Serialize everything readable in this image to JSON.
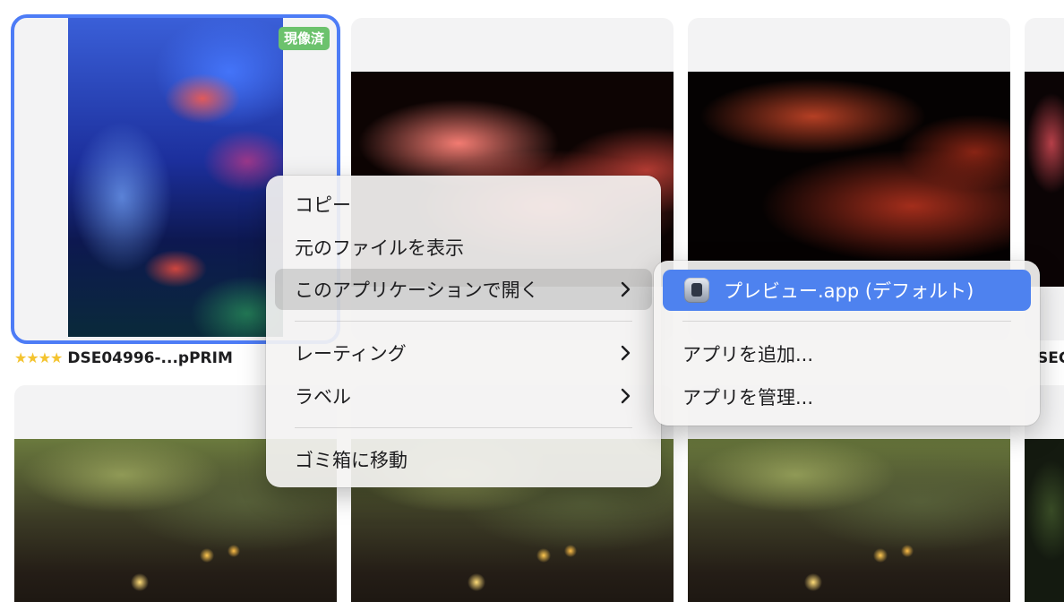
{
  "grid": {
    "tile1": {
      "badge": "現像済",
      "rating": "★★★★",
      "filename": "DSE04996-...pPRIM"
    },
    "tile4_caption_fragment": "SEC"
  },
  "context_menu": {
    "items": {
      "copy": "コピー",
      "show_original": "元のファイルを表示",
      "open_with": "このアプリケーションで開く",
      "rating": "レーティング",
      "label": "ラベル",
      "trash": "ゴミ箱に移動"
    }
  },
  "submenu": {
    "items": {
      "preview_default": "プレビュー.app (デフォルト)",
      "add_app": "アプリを追加...",
      "manage_apps": "アプリを管理..."
    },
    "icons": {
      "preview": "preview-app-icon"
    }
  },
  "colors": {
    "selection_outline": "#4d7cf6",
    "badge_bg": "#6cc26d",
    "menu_highlight": "#4e82ef",
    "stars": "#f4c430"
  }
}
